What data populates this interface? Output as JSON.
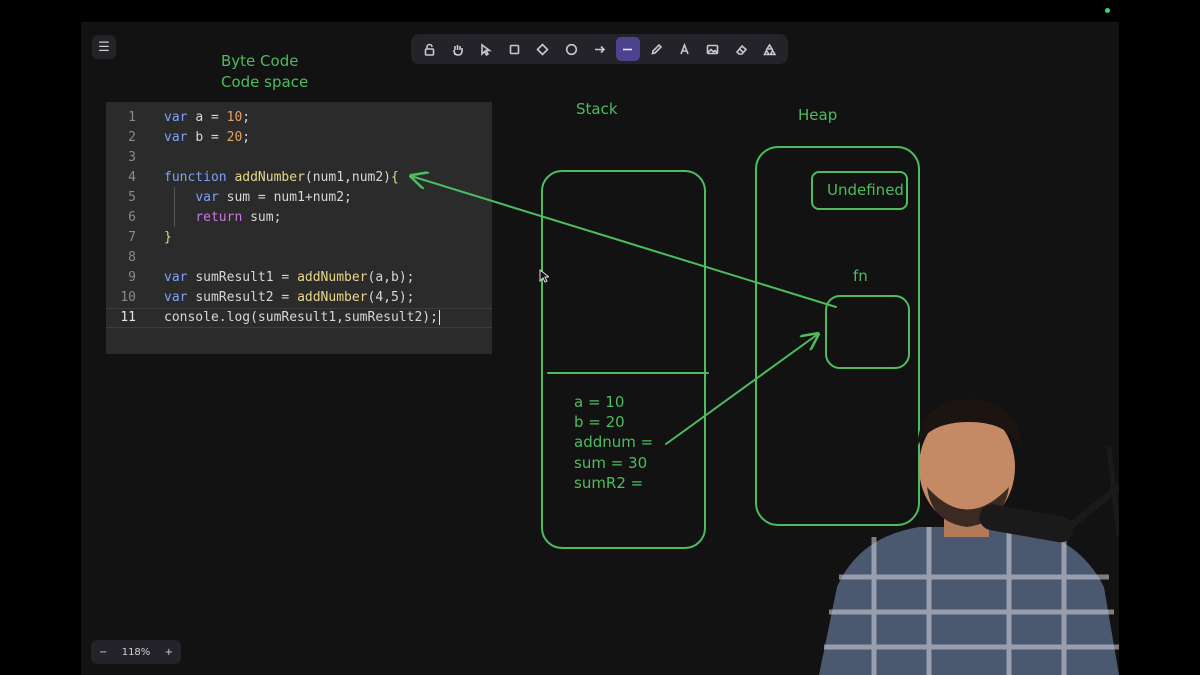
{
  "toolbar": {
    "tools": [
      {
        "name": "lock-icon",
        "active": false
      },
      {
        "name": "hand-icon",
        "active": false
      },
      {
        "name": "selection-icon",
        "active": false
      },
      {
        "name": "rectangle-icon",
        "active": false
      },
      {
        "name": "diamond-icon",
        "active": false
      },
      {
        "name": "ellipse-icon",
        "active": false
      },
      {
        "name": "arrow-icon",
        "active": false
      },
      {
        "name": "line-icon",
        "active": true
      },
      {
        "name": "pencil-icon",
        "active": false
      },
      {
        "name": "text-icon",
        "active": false
      },
      {
        "name": "image-icon",
        "active": false
      },
      {
        "name": "eraser-icon",
        "active": false
      },
      {
        "name": "library-icon",
        "active": false
      }
    ]
  },
  "annotations": {
    "byte_code": "Byte Code",
    "code_space": "Code space",
    "stack": "Stack",
    "heap": "Heap",
    "undefined": "Undefined",
    "fn": "fn",
    "stack_vars": [
      "a = 10",
      "b = 20",
      "addnum =",
      "sum = 30",
      "sumR2 ="
    ]
  },
  "code": {
    "current_line": 11,
    "lines": [
      {
        "n": "1",
        "tokens": [
          [
            "kw",
            "var"
          ],
          [
            "",
            "a = "
          ],
          [
            "num",
            "10"
          ],
          [
            "",
            ";"
          ]
        ]
      },
      {
        "n": "2",
        "tokens": [
          [
            "kw",
            "var"
          ],
          [
            "",
            "b = "
          ],
          [
            "num",
            "20"
          ],
          [
            "",
            ";"
          ]
        ]
      },
      {
        "n": "3",
        "tokens": []
      },
      {
        "n": "4",
        "tokens": [
          [
            "kw",
            "function"
          ],
          [
            "fnc",
            "addNumber"
          ],
          [
            "",
            "(num1,num2)"
          ],
          [
            "fnc",
            "{"
          ]
        ]
      },
      {
        "n": "5",
        "tokens": [
          [
            "",
            "    "
          ],
          [
            "kw",
            "var"
          ],
          [
            "",
            "sum = num1+num2;"
          ]
        ]
      },
      {
        "n": "6",
        "tokens": [
          [
            "",
            "    "
          ],
          [
            "ret",
            "return"
          ],
          [
            "",
            "sum;"
          ]
        ]
      },
      {
        "n": "7",
        "tokens": [
          [
            "fnc",
            "}"
          ]
        ]
      },
      {
        "n": "8",
        "tokens": []
      },
      {
        "n": "9",
        "tokens": [
          [
            "kw",
            "var"
          ],
          [
            "",
            "sumResult1 = "
          ],
          [
            "fnc",
            "addNumber"
          ],
          [
            "",
            "(a,b);"
          ]
        ]
      },
      {
        "n": "10",
        "tokens": [
          [
            "kw",
            "var"
          ],
          [
            "",
            "sumResult2 = "
          ],
          [
            "fnc",
            "addNumber"
          ],
          [
            "",
            "(4,5);"
          ]
        ]
      },
      {
        "n": "11",
        "tokens": [
          [
            "",
            "console.log(sumResult1,sumResult2);"
          ]
        ]
      }
    ]
  },
  "zoom": {
    "minus": "−",
    "level": "118%",
    "plus": "+"
  },
  "colors": {
    "ink": "#4cbc5e",
    "canvas": "#121212",
    "code_bg": "#2b2b2b",
    "active_tool": "#4b4390"
  }
}
